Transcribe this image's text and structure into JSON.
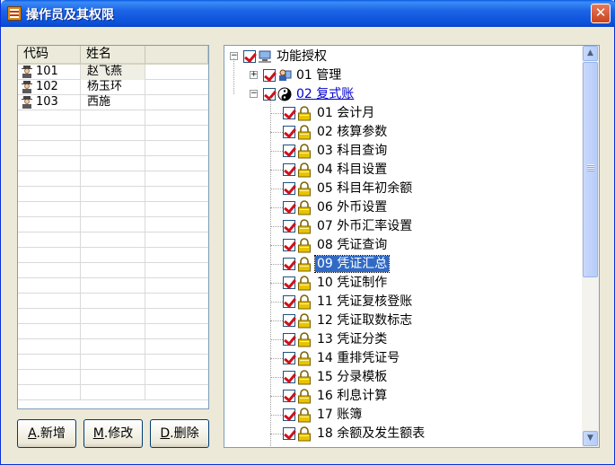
{
  "window": {
    "title": "操作员及其权限",
    "close_label": "✕"
  },
  "userlist": {
    "columns": [
      "代码",
      "姓名",
      ""
    ],
    "rows": [
      {
        "code": "101",
        "name": "赵飞燕"
      },
      {
        "code": "102",
        "name": "杨玉环"
      },
      {
        "code": "103",
        "name": "西施"
      }
    ],
    "empty_rows": 19
  },
  "buttons": {
    "add": {
      "key": "A",
      "label": ".新增"
    },
    "modify": {
      "key": "M",
      "label": ".修改"
    },
    "delete": {
      "key": "D",
      "label": ".删除"
    }
  },
  "tree": {
    "root": "功能授权",
    "group1": "01 管理",
    "group2": "02 复式账",
    "items": [
      "01 会计月",
      "02 核算参数",
      "03 科目查询",
      "04 科目设置",
      "05 科目年初余额",
      "06 外币设置",
      "07 外币汇率设置",
      "08 凭证查询",
      "09 凭证汇总",
      "10 凭证制作",
      "11 凭证复核登账",
      "12 凭证取数标志",
      "13 凭证分类",
      "14 重排凭证号",
      "15 分录模板",
      "16 利息计算",
      "17 账簿",
      "18 余额及发生额表"
    ],
    "selected_index": 8
  },
  "colors": {
    "titlebar": "#0a4fd8",
    "selection": "#316ac5",
    "check": "#d0101a",
    "lock": "#e8c400"
  }
}
